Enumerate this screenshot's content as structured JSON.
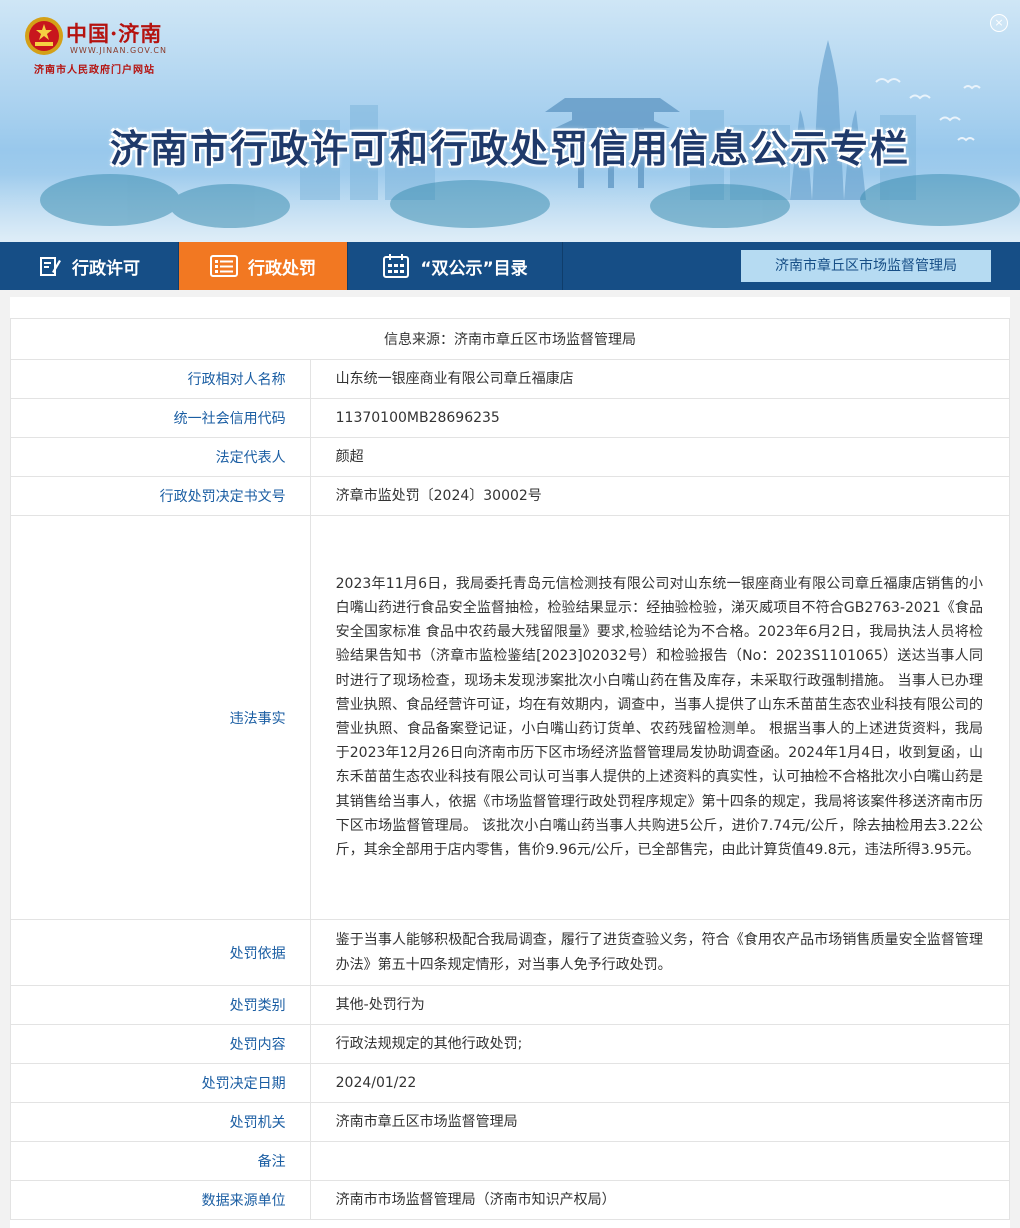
{
  "header": {
    "logo_cn": "中国·济南",
    "logo_url": "WWW.JINAN.GOV.CN",
    "logo_sub": "济南市人民政府门户网站",
    "title": "济南市行政许可和行政处罚信用信息公示专栏",
    "emblem_icon": "national-emblem-icon",
    "close_icon": "close-icon",
    "close_glyph": "×"
  },
  "nav": {
    "items": [
      {
        "label": "行政许可",
        "icon": "document-pen-icon",
        "active": false
      },
      {
        "label": "行政处罚",
        "icon": "list-icon",
        "active": true
      },
      {
        "label": "“双公示”目录",
        "icon": "calendar-icon",
        "active": false
      }
    ],
    "org": "济南市章丘区市场监督管理局",
    "active_color": "#f27822",
    "bar_color": "#164e86"
  },
  "record": {
    "source": "信息来源：济南市章丘区市场监督管理局",
    "rows": [
      {
        "label": "行政相对人名称",
        "value": "山东统一银座商业有限公司章丘福康店"
      },
      {
        "label": "统一社会信用代码",
        "value": "11370100MB28696235"
      },
      {
        "label": "法定代表人",
        "value": "颜超"
      },
      {
        "label": "行政处罚决定书文号",
        "value": "济章市监处罚〔2024〕30002号"
      },
      {
        "label": "违法事实",
        "value": "2023年11月6日，我局委托青岛元信检测技有限公司对山东统一银座商业有限公司章丘福康店销售的小白嘴山药进行食品安全监督抽检，检验结果显示：经抽验检验，涕灭威项目不符合GB2763-2021《食品安全国家标准 食品中农药最大残留限量》要求,检验结论为不合格。2023年6月2日，我局执法人员将检验结果告知书（济章市监检鉴结[2023]02032号）和检验报告（No：2023S1101065）送达当事人同时进行了现场检查，现场未发现涉案批次小白嘴山药在售及库存，未采取行政强制措施。 当事人已办理营业执照、食品经营许可证，均在有效期内，调查中，当事人提供了山东禾苗苗生态农业科技有限公司的营业执照、食品备案登记证，小白嘴山药订货单、农药残留检测单。 根据当事人的上述进货资料，我局于2023年12月26日向济南市历下区市场经济监督管理局发协助调查函。2024年1月4日，收到复函，山东禾苗苗生态农业科技有限公司认可当事人提供的上述资料的真实性，认可抽检不合格批次小白嘴山药是其销售给当事人，依据《市场监督管理行政处罚程序规定》第十四条的规定，我局将该案件移送济南市历下区市场监督管理局。 该批次小白嘴山药当事人共购进5公斤，进价7.74元/公斤，除去抽检用去3.22公斤，其余全部用于店内零售，售价9.96元/公斤，已全部售完，由此计算货值49.8元，违法所得3.95元。"
      },
      {
        "label": "处罚依据",
        "value": "鉴于当事人能够积极配合我局调查，履行了进货查验义务，符合《食用农产品市场销售质量安全监督管理办法》第五十四条规定情形，对当事人免予行政处罚。"
      },
      {
        "label": "处罚类别",
        "value": "其他-处罚行为"
      },
      {
        "label": "处罚内容",
        "value": "行政法规规定的其他行政处罚;"
      },
      {
        "label": "处罚决定日期",
        "value": "2024/01/22"
      },
      {
        "label": "处罚机关",
        "value": "济南市章丘区市场监督管理局"
      },
      {
        "label": "备注",
        "value": ""
      },
      {
        "label": "数据来源单位",
        "value": "济南市市场监督管理局（济南市知识产权局）"
      }
    ]
  }
}
